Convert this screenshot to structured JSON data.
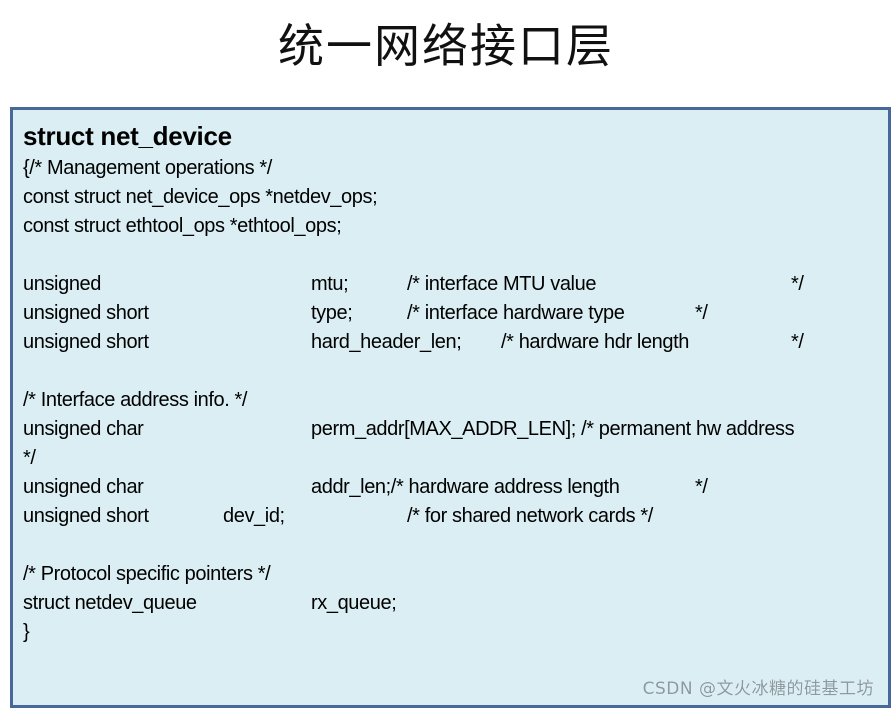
{
  "title": "统一网络接口层",
  "struct_name": "struct net_device",
  "lines": {
    "open_comment": "{/* Management operations */",
    "netdev_ops": "const struct net_device_ops *netdev_ops;",
    "ethtool_ops": "const struct ethtool_ops *ethtool_ops;",
    "mtu": {
      "type": "unsigned",
      "name": "mtu;",
      "comment": "/* interface MTU value",
      "comment_end": "*/"
    },
    "type_field": {
      "type": "unsigned short",
      "name": "type;",
      "comment": "/* interface hardware type",
      "comment_end": "*/"
    },
    "hard_header_len": {
      "type": "unsigned short",
      "name": "hard_header_len;",
      "comment": "/* hardware hdr length",
      "comment_end": "*/"
    },
    "addr_comment": "/* Interface address info. */",
    "perm_addr": {
      "type": "unsigned char",
      "name_and_comment": "perm_addr[MAX_ADDR_LEN]; /* permanent hw address",
      "wrap": "*/"
    },
    "addr_len": {
      "type": "unsigned char",
      "name_and_comment": "addr_len;/* hardware address length",
      "comment_end": "*/"
    },
    "dev_id": {
      "type": "unsigned short",
      "name": "dev_id;",
      "comment": "/* for shared network cards */"
    },
    "protocol_comment": "/* Protocol specific pointers */",
    "rx_queue": {
      "type": "struct netdev_queue",
      "name": "rx_queue;"
    },
    "close_brace": "}"
  },
  "watermark": "CSDN @文火冰糖的硅基工坊"
}
